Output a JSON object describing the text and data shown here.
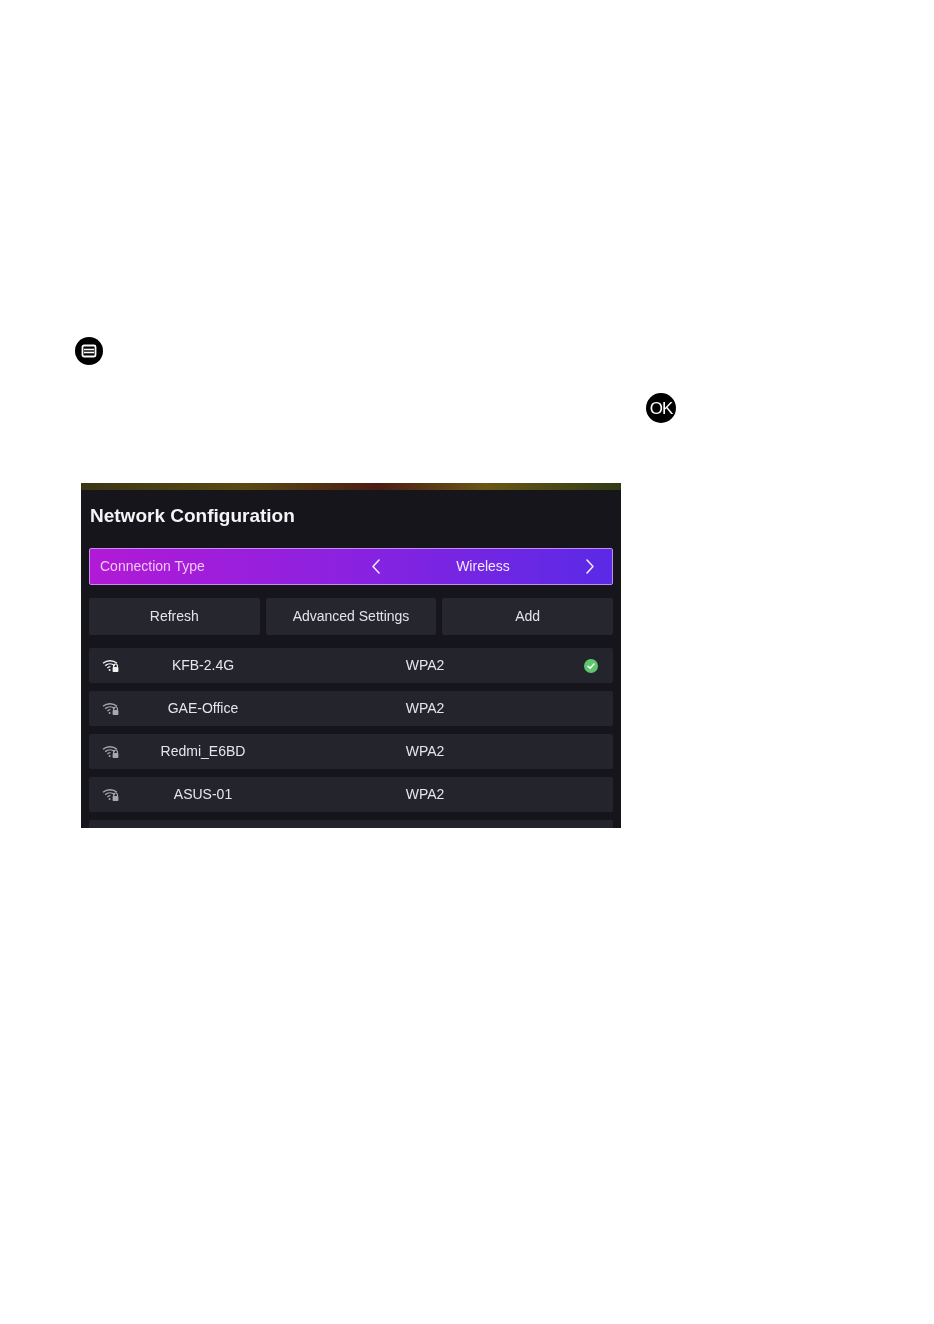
{
  "manual_page": {
    "ok_key": "OK",
    "screenshot": {
      "title": "Network Configuration",
      "connection_type": {
        "label": "Connection Type",
        "value": "Wireless",
        "selected": true
      },
      "buttons": [
        {
          "label": "Refresh",
          "selected": false
        },
        {
          "label": "Advanced Settings",
          "selected": false
        },
        {
          "label": "Add",
          "selected": false
        }
      ],
      "networks": [
        {
          "name": "KFB-2.4G",
          "security": "WPA2",
          "connected": true,
          "selected": false
        },
        {
          "name": "GAE-Office",
          "security": "WPA2",
          "connected": false,
          "selected": false
        },
        {
          "name": "Redmi_E6BD",
          "security": "WPA2",
          "connected": false,
          "selected": false
        },
        {
          "name": "ASUS-01",
          "security": "WPA2",
          "connected": false,
          "selected": false
        }
      ]
    }
  }
}
